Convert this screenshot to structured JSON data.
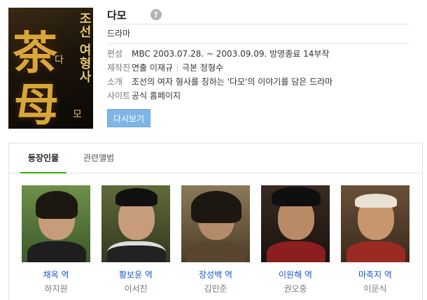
{
  "poster": {
    "big_char_1": "茶",
    "big_char_2": "母",
    "small_1": "다",
    "small_2": "모",
    "vertical_text": "조선 여형사"
  },
  "title": "다모",
  "help_icon": "?",
  "genre": "드라마",
  "details": {
    "format_label": "편성",
    "format_value": "MBC 2003.07.28. ~ 2003.09.09. 방영종료 14부작",
    "crew_label": "제작진",
    "director": "연출 이재규",
    "writer": "극본 정형수",
    "intro_label": "소개",
    "intro_value": "조선의 여자 형사를 칭하는 '다모'의 이야기를 담은 드라마",
    "site_label": "사이트",
    "site_value": "공식 홈페이지"
  },
  "watch_button": "다시보기",
  "tabs": {
    "cast": "등장인물",
    "album": "관련앨범"
  },
  "cast": [
    {
      "role": "채옥 역",
      "actor": "하지원"
    },
    {
      "role": "황보윤 역",
      "actor": "이서진"
    },
    {
      "role": "장성백 역",
      "actor": "김민준"
    },
    {
      "role": "이원해 역",
      "actor": "권오중"
    },
    {
      "role": "마축지 역",
      "actor": "이문식"
    }
  ],
  "colors": {
    "accent_tab": "#2db400",
    "role_link": "#1a55c6",
    "button": "#7fb6e8"
  }
}
